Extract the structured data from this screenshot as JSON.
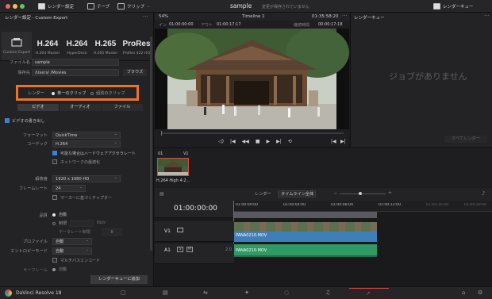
{
  "topbar": {
    "render_settings_label": "レンダー設定",
    "tape_label": "テープ",
    "clips_label": "クリップ",
    "project_title": "sample",
    "save_status": "変更が保存されていません",
    "render_queue_label": "レンダーキュー"
  },
  "left_panel": {
    "title": "レンダー設定 - Custom Export",
    "presets": [
      {
        "big": "",
        "small": "Custom Export"
      },
      {
        "big": "H.264",
        "small": "H.264 Master"
      },
      {
        "big": "H.264",
        "small": "HyperDeck"
      },
      {
        "big": "H.265",
        "small": "H.265 Master"
      },
      {
        "big": "ProRes",
        "small": "ProRes 422 HQ"
      }
    ],
    "filename_label": "ファイル名",
    "filename_value": "sample",
    "location_label": "保存先",
    "location_value": "/Users/        /Movies",
    "browse_label": "ブラウズ",
    "render_label": "レンダー",
    "single_clip_label": "単一のクリップ",
    "individual_clips_label": "個別のクリップ",
    "tabs": [
      "ビデオ",
      "オーディオ",
      "ファイル"
    ],
    "export_video_label": "ビデオの書き出し",
    "format_label": "フォーマット",
    "format_value": "QuickTime",
    "codec_label": "コーデック",
    "codec_value": "H.264",
    "hw_accel_label": "可能な場合はハードウェアアクセラレート",
    "network_opt_label": "ネットワークの最適化",
    "resolution_label": "解像度",
    "resolution_value": "1920 x 1080 HD",
    "framerate_label": "フレームレート",
    "framerate_value": "24",
    "marker_label": "マーカーに基づくチャプター",
    "quality_label": "品質",
    "auto_label": "自動",
    "limit_label": "制限",
    "limit_unit": "Kb/s",
    "datarate_label": "データレート制限",
    "datarate_value": "8",
    "profile_label": "プロファイル",
    "profile_value": "自動",
    "entropy_label": "エントロピーモード",
    "entropy_value": "自動",
    "multipass_label": "マルチパスエンコード",
    "keyframe_label": "キーフレーム",
    "keyframe_value": "自動",
    "add_queue_label": "レンダーキューに追加"
  },
  "viewer": {
    "zoom": "54%",
    "timeline_name": "Timeline 1",
    "timecode": "01:35:58:20",
    "in_label": "イン",
    "in_value": "01:00:00:00",
    "out_label": "アウト",
    "out_value": "01:00:17:17",
    "duration_label": "継続時間",
    "duration_value": "00:00:17:18"
  },
  "queue": {
    "empty_message": "ジョブがありません",
    "render_all_label": "すべてレンダー"
  },
  "clips": {
    "index": "01",
    "track": "V1",
    "clip_name": "H.264 High 4:2..."
  },
  "timeline_toolbar": {
    "render_label": "レンダー",
    "range_value": "タイムライン全体"
  },
  "timeline": {
    "current_tc": "01:00:00:00",
    "ruler_marks": [
      "01:00:00:00",
      "01:00:04:00",
      "01:00:08:00",
      "01:00:12:00",
      "01:00:16:00",
      "01:00:20:00"
    ],
    "v1_label": "V1",
    "a1_label": "A1",
    "a1_level": "2.0",
    "video_clip_name": "PANA0210.MOV",
    "audio_clip_name": "PANA0210.MOV"
  },
  "bottombar": {
    "app_name": "DaVinci Resolve 18"
  },
  "colors": {
    "accent": "#e8742a",
    "clip_video": "#3f7fb8",
    "clip_audio": "#2f9a63",
    "playhead": "#d94a3a"
  }
}
